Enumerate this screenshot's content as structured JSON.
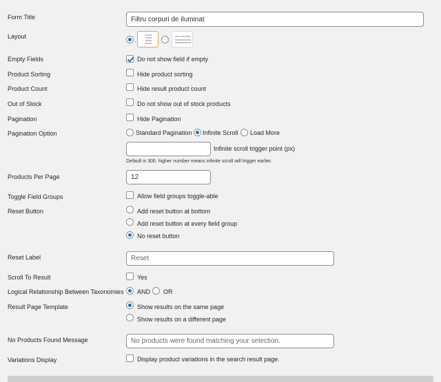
{
  "form_title": {
    "label": "Form Title",
    "value": "Filtru corpuri de iluminat"
  },
  "layout": {
    "label": "Layout",
    "options": [
      "vertical-layout",
      "horizontal-layout"
    ],
    "selected": "vertical-layout"
  },
  "empty_fields": {
    "label": "Empty Fields",
    "checkbox_label": "Do not show field if empty",
    "checked": true
  },
  "product_sorting": {
    "label": "Product Sorting",
    "checkbox_label": "Hide product sorting",
    "checked": false
  },
  "product_count": {
    "label": "Product Count",
    "checkbox_label": "Hide result product count",
    "checked": false
  },
  "out_of_stock": {
    "label": "Out of Stock",
    "checkbox_label": "Do not show out of stock products",
    "checked": false
  },
  "pagination": {
    "label": "Pagination",
    "checkbox_label": "Hide Pagination",
    "checked": false
  },
  "pagination_option": {
    "label": "Pagination Option",
    "options": [
      "Standard Pagination",
      "Infinite Scroll",
      "Load More"
    ],
    "selected": "Infinite Scroll",
    "trigger_label": "Infinite scroll trigger point (px)",
    "trigger_value": "",
    "help": "Default is 300. higher number means infinite scroll will trigger earlier."
  },
  "products_per_page": {
    "label": "Products Per Page",
    "value": "12"
  },
  "toggle_field_groups": {
    "label": "Toggle Field Groups",
    "checkbox_label": "Allow field groups toggle-able",
    "checked": false
  },
  "reset_button": {
    "label": "Reset Button",
    "options": [
      "Add reset button at bottom",
      "Add reset button at every field group",
      "No reset button"
    ],
    "selected": "No reset button"
  },
  "reset_label": {
    "label": "Reset Label",
    "placeholder": "Reset"
  },
  "scroll_to_result": {
    "label": "Scroll To Result",
    "checkbox_label": "Yes",
    "checked": false
  },
  "logical_relationship": {
    "label": "Logical Relationship Between Taxonomies",
    "options": [
      "AND",
      "OR"
    ],
    "selected": "AND"
  },
  "result_page_template": {
    "label": "Result Page Template",
    "options": [
      "Show results on the same page",
      "Show results on a different page"
    ],
    "selected": "Show results on the same page"
  },
  "no_products_message": {
    "label": "No Products Found Message",
    "placeholder": "No products were found matching your selection."
  },
  "variations_display": {
    "label": "Variations Display",
    "checkbox_label": "Display product variations in the search result page.",
    "checked": false
  },
  "colors": {
    "accent": "#2271b1",
    "background": "#f1f1f1",
    "selected_layout_border": "#e8a25a"
  }
}
